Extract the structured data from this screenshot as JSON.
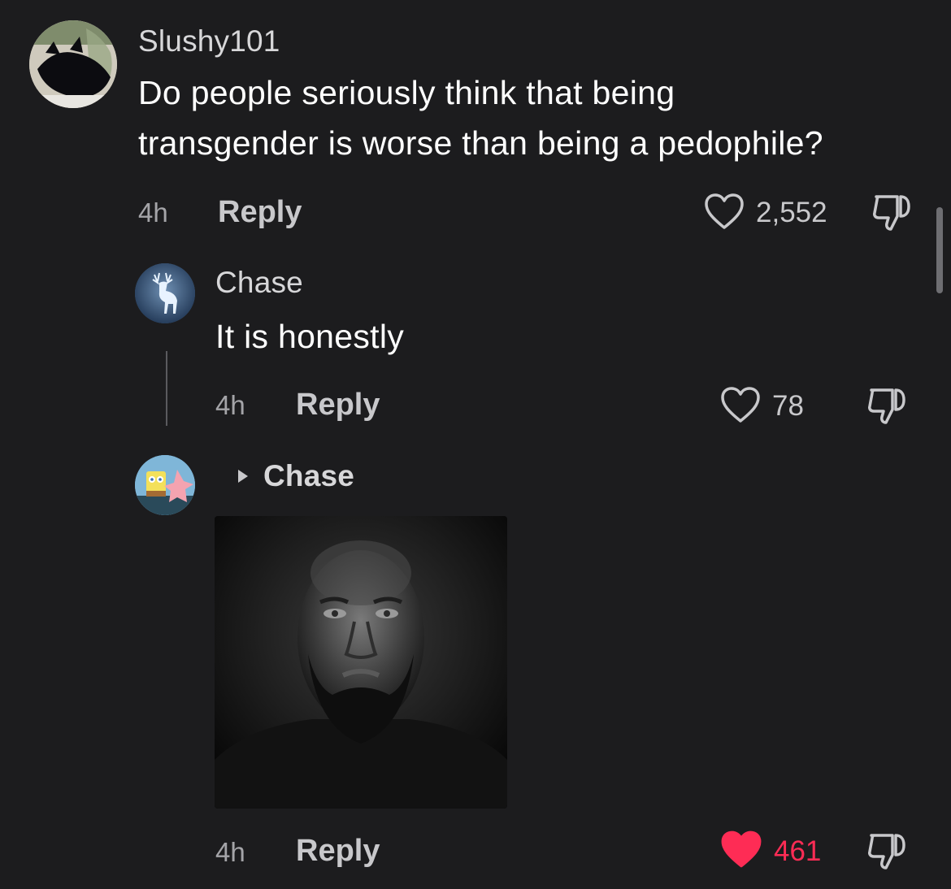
{
  "scrollbar": {
    "visible": true
  },
  "comments": [
    {
      "username": "Slushy101",
      "text_line1": "Do people seriously think that being",
      "text_line2": "transgender is worse than being a pedophile?",
      "time": "4h",
      "reply_label": "Reply",
      "likes": "2,552",
      "liked": false,
      "avatar": "black-cat-avatar"
    },
    {
      "username": "Chase",
      "text": "It is honestly",
      "time": "4h",
      "reply_label": "Reply",
      "likes": "78",
      "liked": false,
      "avatar": "white-deer-avatar"
    },
    {
      "reply_to": "Chase",
      "media": "grayscale-portrait-image",
      "time": "4h",
      "reply_label": "Reply",
      "likes": "461",
      "liked": true,
      "avatar": "spongebob-patrick-avatar"
    }
  ],
  "colors": {
    "background": "#1c1c1e",
    "liked_heart": "#fe2c55",
    "secondary_text": "#a4a4a8"
  }
}
